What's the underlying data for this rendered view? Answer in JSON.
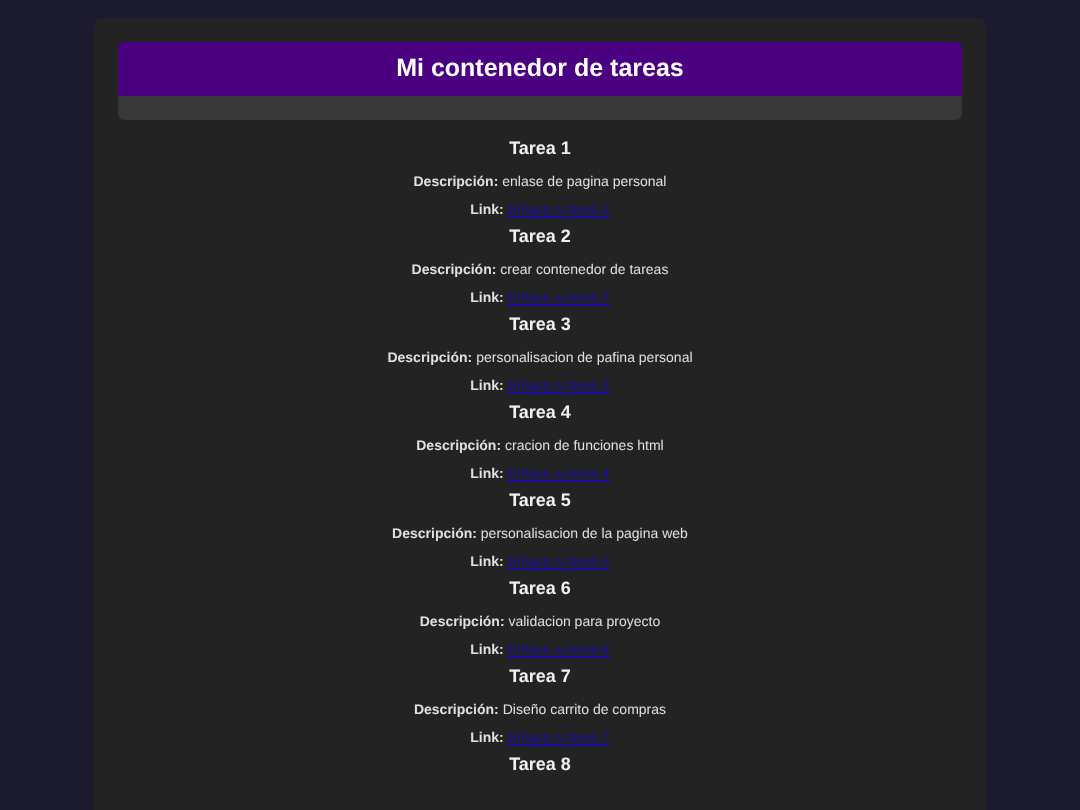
{
  "header": {
    "title": "Mi contenedor de tareas"
  },
  "tasks": [
    {
      "title": "Tarea 1",
      "description_label": "Descripción:",
      "description": "enlase de pagina personal",
      "link_label": "Link:",
      "link": "Enlace a tarea 1"
    },
    {
      "title": "Tarea 2",
      "description_label": "Descripción:",
      "description": "crear contenedor de tareas",
      "link_label": "Link:",
      "link": "Enlace a tarea 2"
    },
    {
      "title": "Tarea 3",
      "description_label": "Descripción:",
      "description": "personalisacion de pafina personal",
      "link_label": "Link:",
      "link": "Enlace a tarea 3"
    },
    {
      "title": "Tarea 4",
      "description_label": "Descripción:",
      "description": "cracion de funciones html",
      "link_label": "Link:",
      "link": "Enlace a tarea 4"
    },
    {
      "title": "Tarea 5",
      "description_label": "Descripción:",
      "description": "personalisacion de la pagina web",
      "link_label": "Link:",
      "link": "Enlace a tarea 5"
    },
    {
      "title": "Tarea 6",
      "description_label": "Descripción:",
      "description": "validacion para proyecto",
      "link_label": "Link:",
      "link": "Enlace a tarea 6"
    },
    {
      "title": "Tarea 7",
      "description_label": "Descripción:",
      "description": "Diseño carrito de compras",
      "link_label": "Link:",
      "link": "Enlace a tarea 7"
    },
    {
      "title": "Tarea 8"
    }
  ]
}
